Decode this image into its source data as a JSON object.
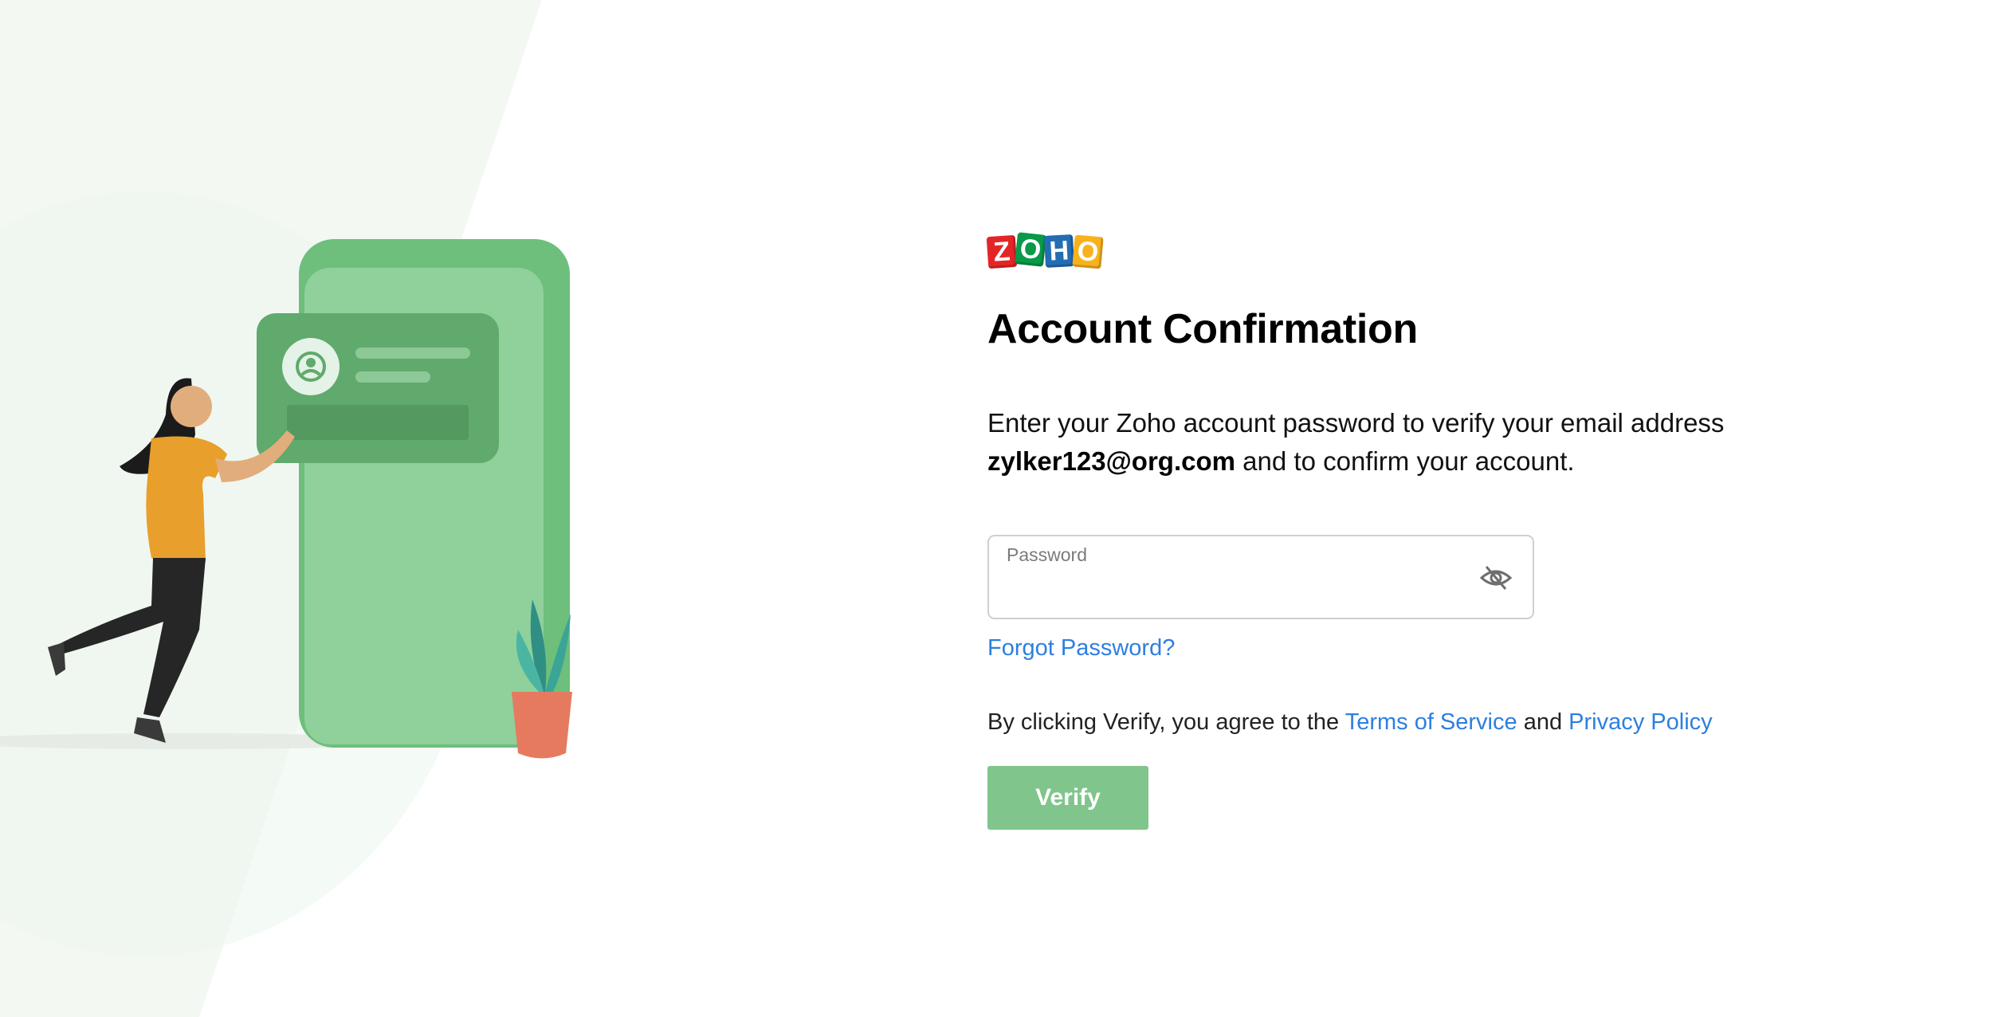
{
  "brand": {
    "logo_letters": [
      "Z",
      "O",
      "H",
      "O"
    ],
    "logo_colors": [
      "#e42527",
      "#089949",
      "#226db4",
      "#f9b21d"
    ]
  },
  "illustration": {
    "icon": "woman-with-phone-illustration",
    "accent_color": "#6dbf7b"
  },
  "form": {
    "title": "Account Confirmation",
    "description_prefix": "Enter your Zoho account password to verify your email address",
    "email": "zylker123@org.com",
    "description_suffix": "and to confirm your account.",
    "password": {
      "label": "Password",
      "value": "",
      "toggle_icon": "eye-slash-icon"
    },
    "forgot_password": "Forgot Password?",
    "terms": {
      "prefix": "By clicking Verify, you agree to the",
      "terms_link": "Terms of Service",
      "conjunction": "and",
      "privacy_link": "Privacy Policy"
    },
    "verify_label": "Verify"
  },
  "colors": {
    "link": "#2d7fe0",
    "verify_button": "#80c58b",
    "title": "#000000"
  }
}
